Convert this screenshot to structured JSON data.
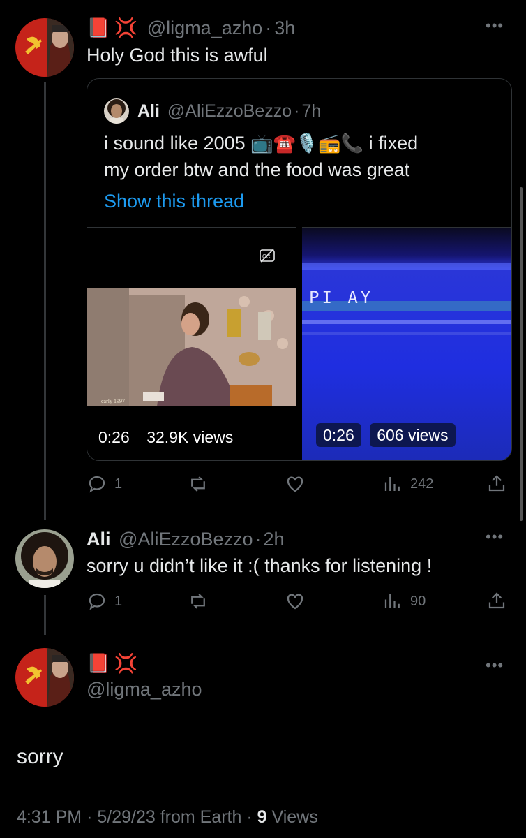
{
  "tweet1": {
    "handle": "@ligma_azho",
    "sep": "·",
    "time": "3h",
    "text": "Holy God this is awful",
    "emoji_book": "📕",
    "emoji_anger": "💢"
  },
  "quote": {
    "name": "Ali",
    "handle": "@AliEzzoBezzo",
    "sep": "·",
    "time": "7h",
    "line1_a": "i sound like 2005",
    "emojis": "📺☎️🎙️📻📞",
    "line1_b": "i fixed",
    "line2": "my order btw and the food was great",
    "show_thread": "Show this thread",
    "video1": {
      "duration": "0:26",
      "views": "32.9K views",
      "watermark": "carly 1997"
    },
    "video2": {
      "duration": "0:26",
      "views": "606 views",
      "overlay": "PI AY"
    }
  },
  "tweet1_actions": {
    "replies": "1",
    "views": "242"
  },
  "tweet2": {
    "name": "Ali",
    "handle": "@AliEzzoBezzo",
    "sep": "·",
    "time": "2h",
    "text": "sorry u didn’t like it :( thanks for listening !",
    "replies": "1",
    "views": "90"
  },
  "tweet3": {
    "emoji_book": "📕",
    "emoji_anger": "💢",
    "handle": "@ligma_azho",
    "text": "sorry",
    "time": "4:31 PM",
    "date": "5/29/23 from Earth",
    "views_count": "9",
    "views_label": " Views"
  },
  "colors": {
    "accent": "#1d9bf0",
    "muted": "#71767b",
    "background": "#000000"
  }
}
